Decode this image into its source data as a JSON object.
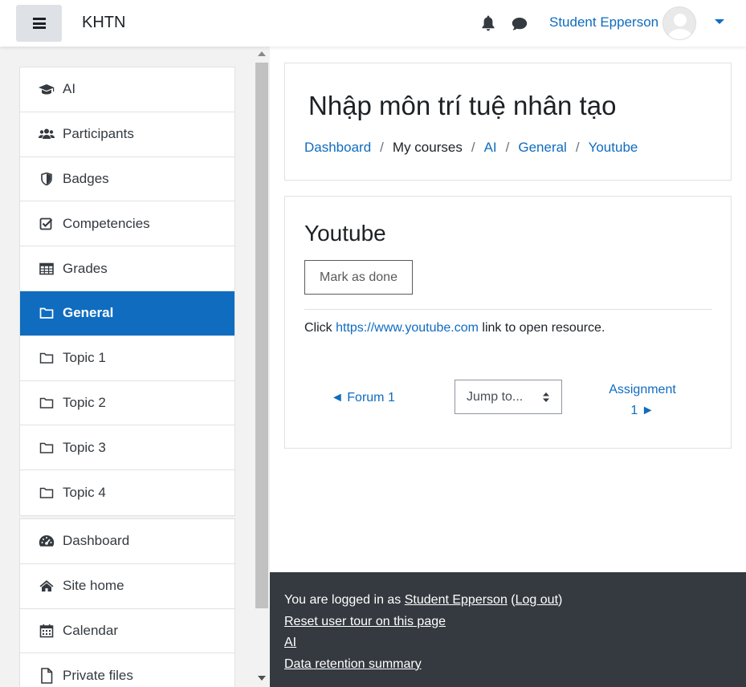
{
  "navbar": {
    "brand": "KHTN",
    "user_name": "Student Epperson"
  },
  "drawer": {
    "course_items": [
      {
        "label": "AI",
        "icon": "graduation-cap-icon"
      },
      {
        "label": "Participants",
        "icon": "users-icon"
      },
      {
        "label": "Badges",
        "icon": "shield-icon"
      },
      {
        "label": "Competencies",
        "icon": "checkbox-icon"
      },
      {
        "label": "Grades",
        "icon": "table-icon"
      },
      {
        "label": "General",
        "icon": "folder-icon",
        "active": true
      },
      {
        "label": "Topic 1",
        "icon": "folder-icon"
      },
      {
        "label": "Topic 2",
        "icon": "folder-icon"
      },
      {
        "label": "Topic 3",
        "icon": "folder-icon"
      },
      {
        "label": "Topic 4",
        "icon": "folder-icon"
      }
    ],
    "site_items": [
      {
        "label": "Dashboard",
        "icon": "dashboard-icon"
      },
      {
        "label": "Site home",
        "icon": "home-icon"
      },
      {
        "label": "Calendar",
        "icon": "calendar-icon"
      },
      {
        "label": "Private files",
        "icon": "file-icon"
      }
    ]
  },
  "header": {
    "title": "Nhập môn trí tuệ nhân tạo",
    "breadcrumb": [
      "Dashboard",
      "My courses",
      "AI",
      "General",
      "Youtube"
    ]
  },
  "activity": {
    "title": "Youtube",
    "mark_done_label": "Mark as done",
    "click_prefix": "Click ",
    "url": "https://www.youtube.com",
    "click_suffix": " link to open resource.",
    "prev_label": "◄ Forum 1",
    "jump_label": "Jump to...",
    "next_label_line1": "Assignment",
    "next_label_line2": "1 ►"
  },
  "footer": {
    "logged_in_prefix": "You are logged in as ",
    "user_name": "Student Epperson",
    "logout_label": "Log out",
    "reset_tour": "Reset user tour on this page",
    "course_link": "AI",
    "data_retention": "Data retention summary"
  },
  "colors": {
    "primary": "#0f6cbf",
    "footer_bg": "#343a40",
    "drawer_bg": "#f2f2f2"
  }
}
